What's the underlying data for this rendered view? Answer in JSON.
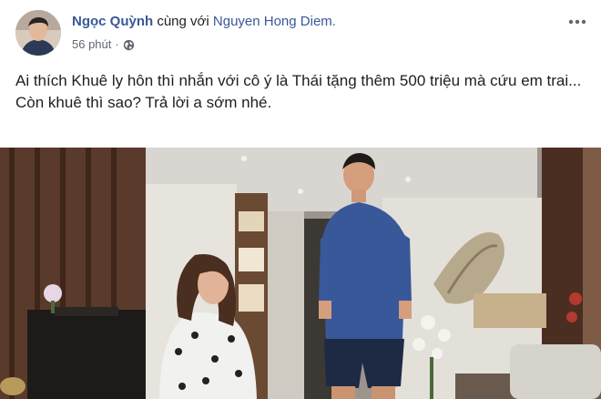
{
  "post": {
    "author": "Ngọc Quỳnh",
    "with_text": "cùng với",
    "tagged": "Nguyen Hong Diem.",
    "timestamp": "56 phút",
    "separator": "·",
    "privacy_icon": "globe-icon",
    "menu_icon": "more-options-icon",
    "text_line1": "Ai thích Khuê ly hôn thì nhắn với cô ý là Thái tặng thêm 500 triệu mà cứu em trai...",
    "text_line2": "Còn khuê thì sao? Trả lời a sớm nhé."
  },
  "colors": {
    "link": "#385898",
    "meta": "#606770",
    "text": "#1c1e21"
  }
}
